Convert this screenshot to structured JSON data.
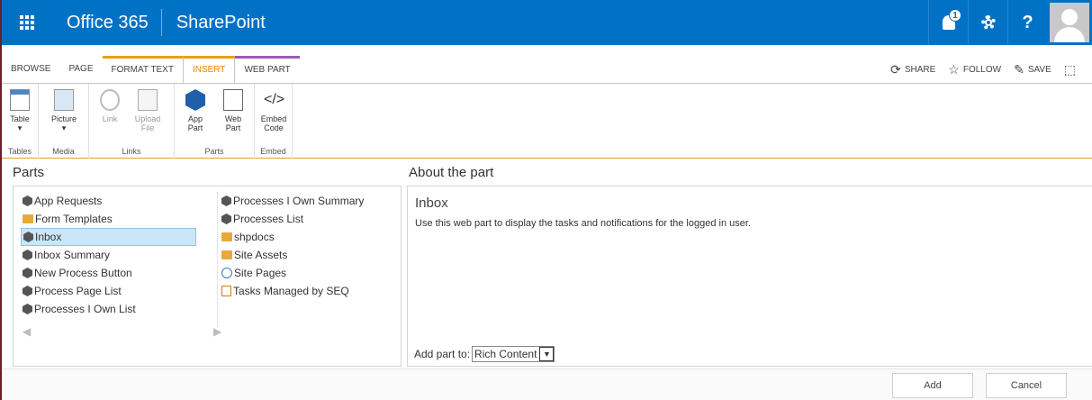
{
  "suite": {
    "brand": "Office 365",
    "app": "SharePoint",
    "notification_count": "1",
    "help": "?"
  },
  "tabs": [
    {
      "label": "BROWSE"
    },
    {
      "label": "PAGE"
    },
    {
      "label": "FORMAT TEXT"
    },
    {
      "label": "INSERT"
    },
    {
      "label": "WEB PART"
    }
  ],
  "actions": {
    "share": "SHARE",
    "follow": "FOLLOW",
    "save": "SAVE"
  },
  "ribbon": {
    "groups": [
      {
        "label": "Tables",
        "buttons": [
          {
            "label": "Table"
          }
        ]
      },
      {
        "label": "Media",
        "buttons": [
          {
            "label": "Picture"
          }
        ]
      },
      {
        "label": "Links",
        "buttons": [
          {
            "label": "Link"
          },
          {
            "label": "Upload File"
          }
        ]
      },
      {
        "label": "Parts",
        "buttons": [
          {
            "label": "App Part"
          },
          {
            "label": "Web Part"
          }
        ]
      },
      {
        "label": "Embed",
        "buttons": [
          {
            "label": "Embed Code"
          }
        ]
      }
    ]
  },
  "parts": {
    "title": "Parts",
    "col1": [
      "App Requests",
      "Form Templates",
      "Inbox",
      "Inbox Summary",
      "New Process Button",
      "Process Page List",
      "Processes I Own List"
    ],
    "col2": [
      "Processes I Own Summary",
      "Processes List",
      "shpdocs",
      "Site Assets",
      "Site Pages",
      "Tasks Managed by SEQ"
    ],
    "col1_icons": [
      "hex-icon",
      "folder-icon",
      "hex-icon",
      "hex-icon",
      "hex-icon",
      "hex-icon",
      "hex-icon"
    ],
    "col2_icons": [
      "hex-icon",
      "hex-icon",
      "folder-icon",
      "folder-icon",
      "globe-icon",
      "task-icon"
    ]
  },
  "about": {
    "title": "About the part",
    "name": "Inbox",
    "description": "Use this web part to display the tasks and notifications for the logged in user.",
    "add_to_label": "Add part to:",
    "add_to_value": "Rich Content"
  },
  "footer": {
    "add": "Add",
    "cancel": "Cancel"
  },
  "colors": {
    "suite_bar": "#0072c6",
    "selected_tab": "#f08200",
    "context_tab": "#f39c12",
    "webpart_tab": "#9b59b6",
    "selection": "#cde6f7"
  }
}
